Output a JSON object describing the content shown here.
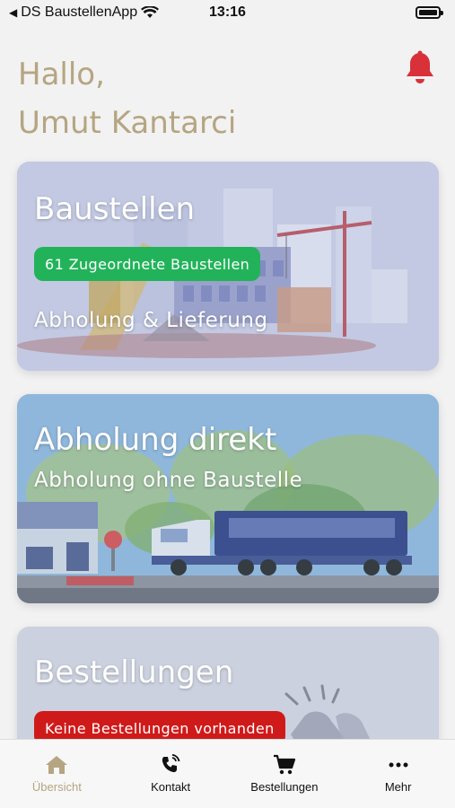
{
  "status_bar": {
    "back_app": "DS BaustellenApp",
    "time": "13:16"
  },
  "greeting": {
    "line1": "Hallo,",
    "line2": "Umut Kantarci"
  },
  "cards": {
    "baustellen": {
      "title": "Baustellen",
      "badge": "61 Zugeordnete Baustellen",
      "subtitle": "Abholung & Lieferung"
    },
    "abholung": {
      "title": "Abholung direkt",
      "subtitle": "Abholung ohne Baustelle"
    },
    "bestellungen": {
      "title": "Bestellungen",
      "badge": "Keine Bestellungen vorhanden"
    }
  },
  "tabs": [
    {
      "label": "Übersicht",
      "icon": "home-icon",
      "active": true
    },
    {
      "label": "Kontakt",
      "icon": "phone-icon"
    },
    {
      "label": "Bestellungen",
      "icon": "cart-icon"
    },
    {
      "label": "Mehr",
      "icon": "more-icon"
    }
  ],
  "colors": {
    "accent": "#b5a582",
    "bell": "#d9313a",
    "badge_green": "#22b35a",
    "badge_red": "#cf1a1a"
  }
}
